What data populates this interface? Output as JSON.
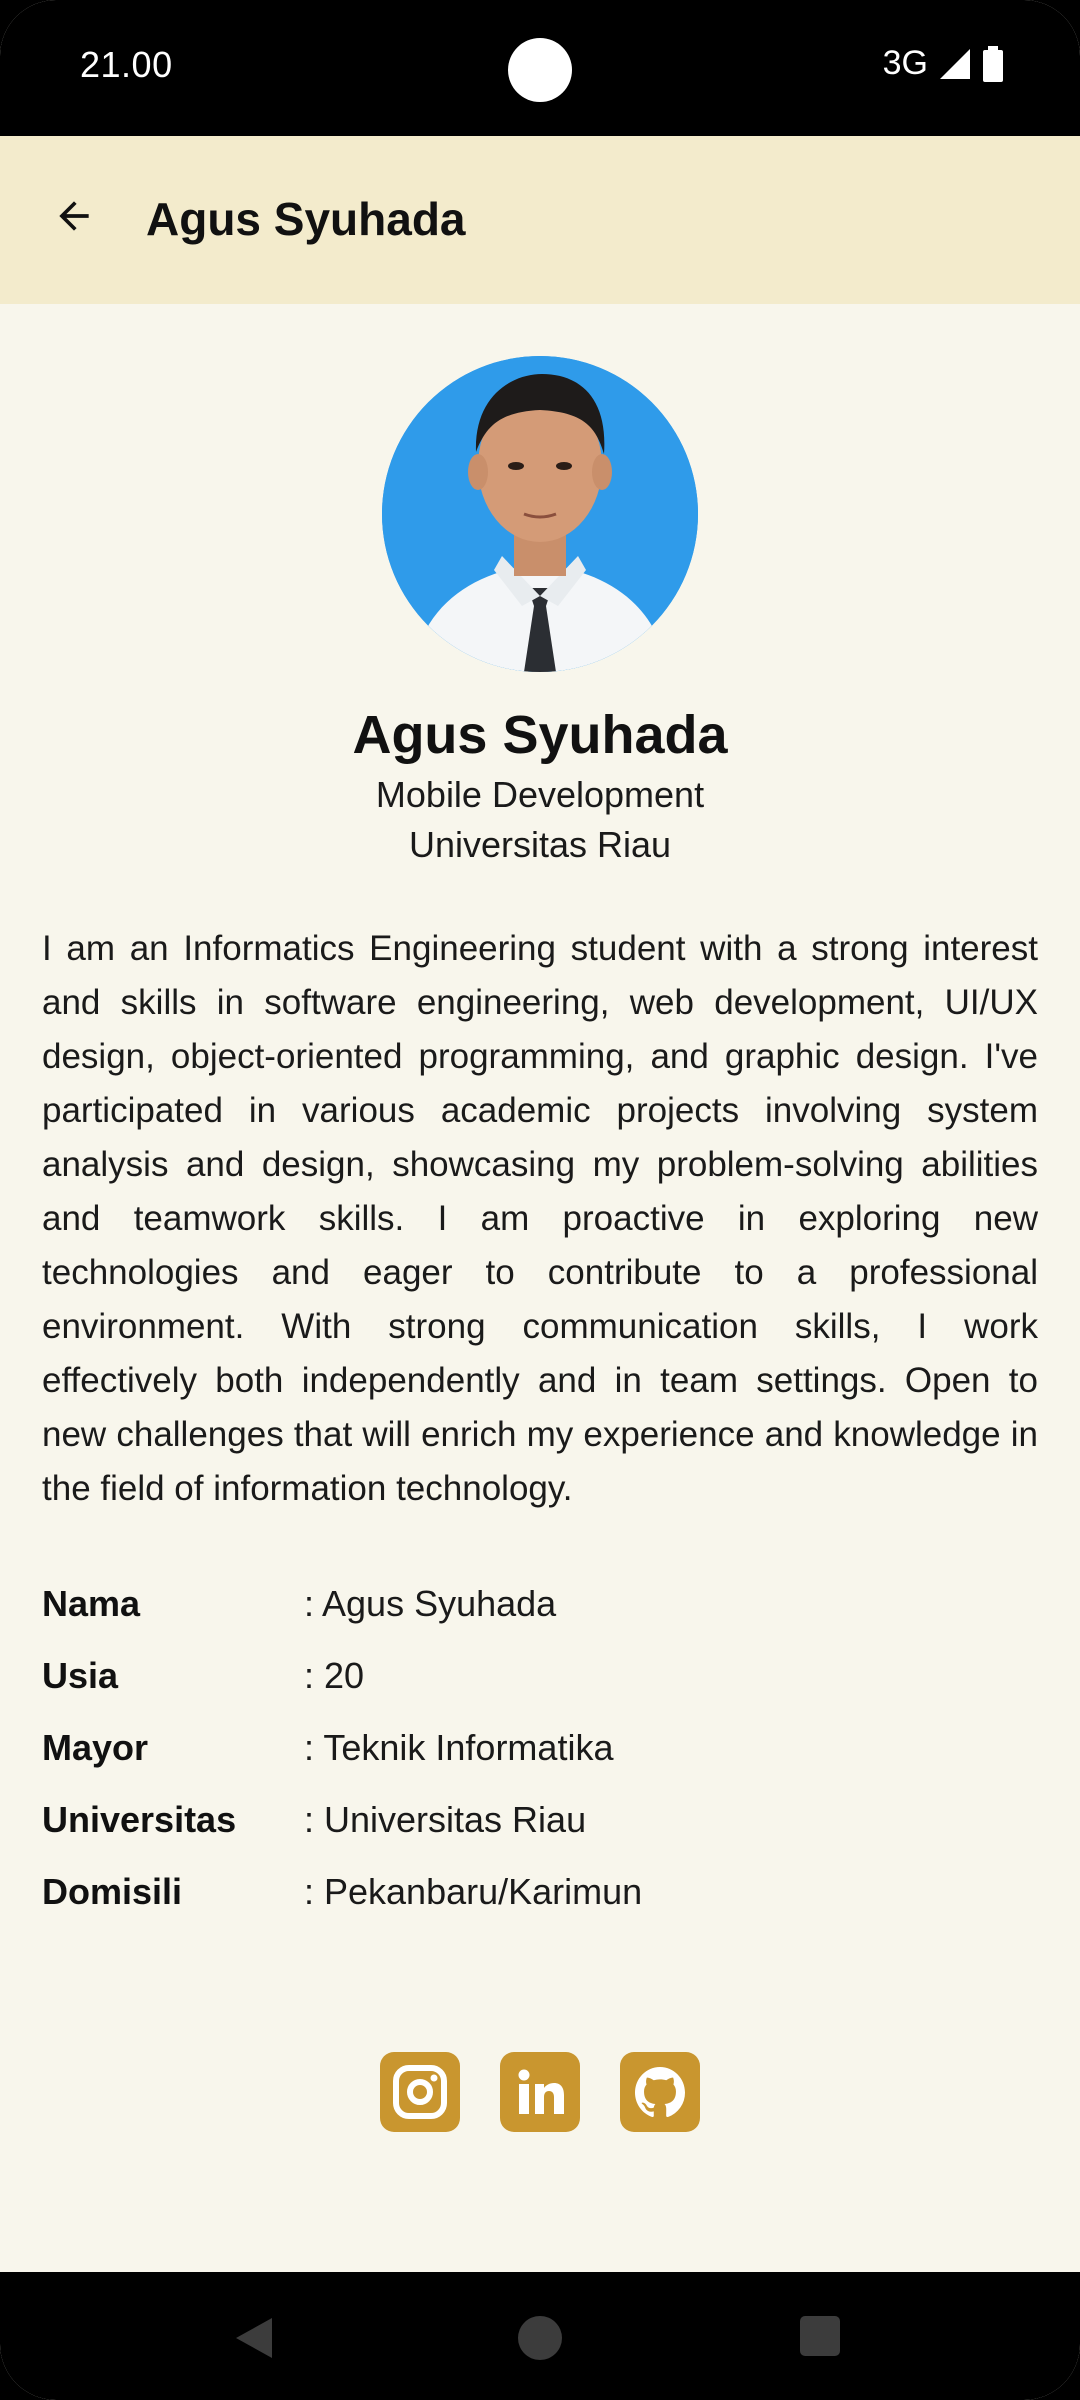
{
  "status_bar": {
    "time": "21.00",
    "network": "3G"
  },
  "app_bar": {
    "title": "Agus Syuhada",
    "back_icon": "arrow-back-icon"
  },
  "profile": {
    "name": "Agus Syuhada",
    "role": "Mobile Development",
    "university": "Universitas Riau",
    "bio": "I am an Informatics Engineering student with a strong interest and skills in software engineering, web development, UI/UX design, object-oriented programming, and graphic design. I've participated in various academic projects involving system analysis and design, showcasing my problem-solving abilities and teamwork skills. I am proactive in exploring new technologies and eager to contribute to a professional environment. With strong communication skills, I work effectively both independently and in team settings. Open to new challenges that will enrich my experience and knowledge in the field of information technology."
  },
  "details": [
    {
      "label": "Nama",
      "value": ": Agus Syuhada"
    },
    {
      "label": "Usia",
      "value": ": 20"
    },
    {
      "label": "Mayor",
      "value": ": Teknik Informatika"
    },
    {
      "label": "Universitas",
      "value": ": Universitas Riau"
    },
    {
      "label": "Domisili",
      "value": ": Pekanbaru/Karimun"
    }
  ],
  "social": [
    {
      "icon": "instagram-icon"
    },
    {
      "icon": "linkedin-icon"
    },
    {
      "icon": "github-icon"
    }
  ],
  "colors": {
    "background": "#F8F6EC",
    "app_bar": "#F3EBCC",
    "accent": "#C9962F",
    "avatar_bg": "#2F9BEA"
  }
}
